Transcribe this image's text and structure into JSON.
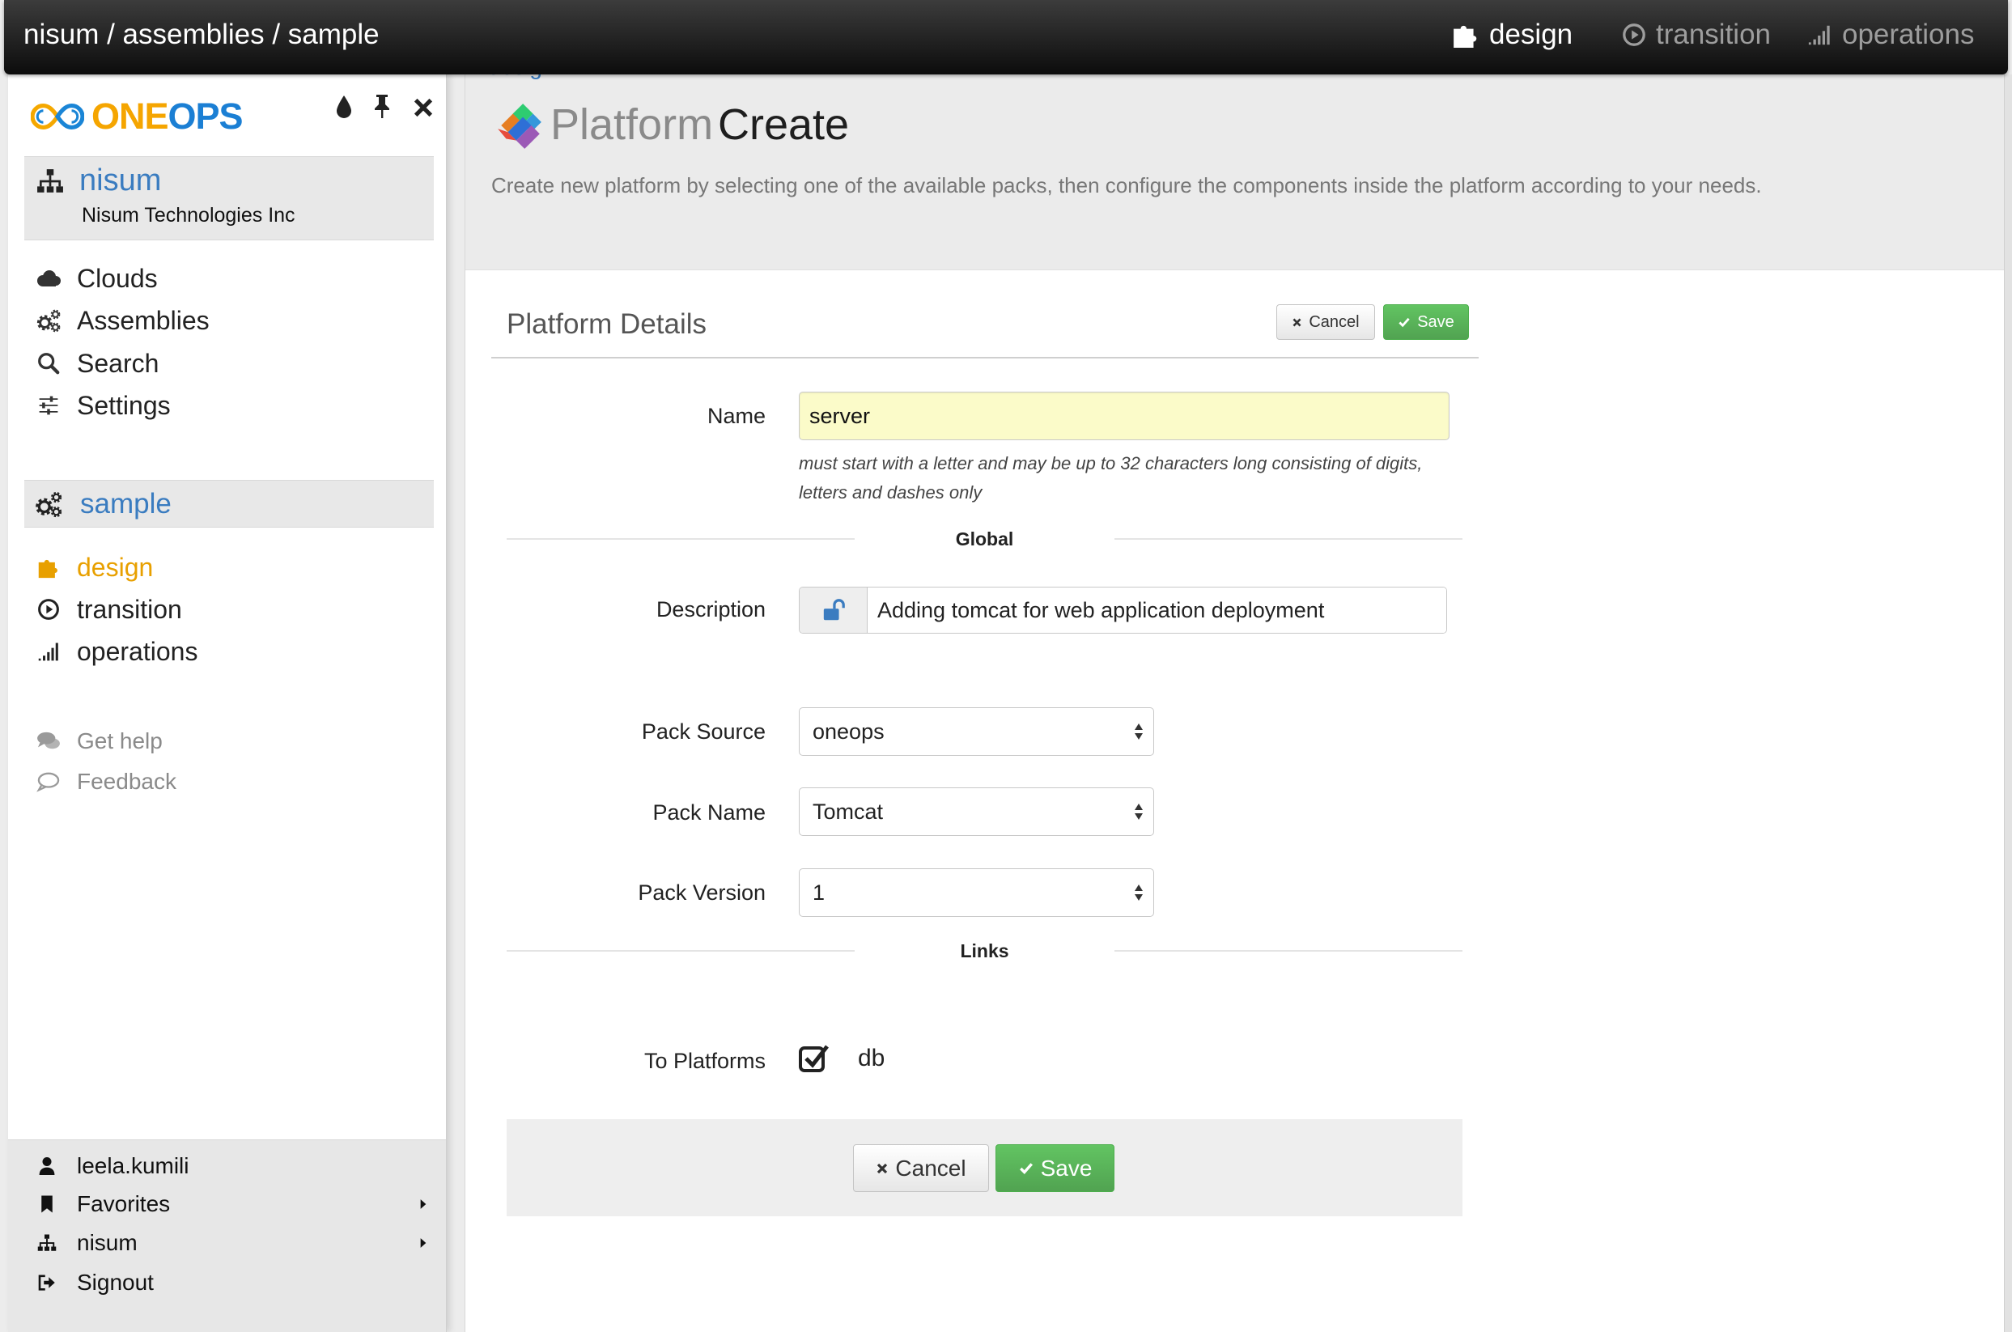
{
  "topbar": {
    "breadcrumb": "nisum / assemblies / sample",
    "nav": [
      {
        "label": "design",
        "icon": "puzzle-icon",
        "active": true
      },
      {
        "label": "transition",
        "icon": "play-circle-icon",
        "active": false
      },
      {
        "label": "operations",
        "icon": "signal-bars-icon",
        "active": false
      }
    ]
  },
  "sidebar": {
    "logo": {
      "part1": "ONE",
      "part2": "OPS",
      "icon": "infinity-logo-icon"
    },
    "toolbar_icons": [
      "droplet-icon",
      "pin-icon",
      "close-icon"
    ],
    "organization": {
      "name": "nisum",
      "full_name": "Nisum Technologies Inc",
      "icon": "sitemap-icon"
    },
    "menu": [
      {
        "label": "Clouds",
        "icon": "cloud-icon"
      },
      {
        "label": "Assemblies",
        "icon": "gears-icon"
      },
      {
        "label": "Search",
        "icon": "search-icon"
      },
      {
        "label": "Settings",
        "icon": "sliders-icon"
      }
    ],
    "assembly": {
      "name": "sample",
      "icon": "gears-icon"
    },
    "assembly_menu": [
      {
        "label": "design",
        "icon": "puzzle-icon",
        "active": true
      },
      {
        "label": "transition",
        "icon": "play-circle-icon",
        "active": false
      },
      {
        "label": "operations",
        "icon": "signal-bars-icon",
        "active": false
      }
    ],
    "help_links": [
      {
        "label": "Get help",
        "icon": "comments-icon"
      },
      {
        "label": "Feedback",
        "icon": "comment-outline-icon"
      }
    ],
    "user_menu": [
      {
        "label": "leela.kumili",
        "icon": "user-icon",
        "has_submenu": false
      },
      {
        "label": "Favorites",
        "icon": "bookmark-icon",
        "has_submenu": true
      },
      {
        "label": "nisum",
        "icon": "sitemap-icon",
        "has_submenu": true
      },
      {
        "label": "Signout",
        "icon": "sign-out-icon",
        "has_submenu": false
      }
    ]
  },
  "page": {
    "breadcrumb": "design",
    "icon": "platform-icon",
    "title_prefix": "Platform",
    "title": "Create",
    "description": "Create new platform by selecting one of the available packs, then configure the components inside the platform according to your needs."
  },
  "form": {
    "heading": "Platform Details",
    "top_cancel_label": "Cancel",
    "top_save_label": "Save",
    "name": {
      "label": "Name",
      "value": "server",
      "help": "must start with a letter and may be up to 32 characters long consisting of digits, letters and dashes only"
    },
    "section_global": "Global",
    "description": {
      "label": "Description",
      "value": "Adding tomcat for web application deployment",
      "lock_icon": "unlock-icon"
    },
    "pack_source": {
      "label": "Pack Source",
      "selected": "oneops"
    },
    "pack_name": {
      "label": "Pack Name",
      "selected": "Tomcat"
    },
    "pack_version": {
      "label": "Pack Version",
      "selected": "1"
    },
    "section_links": "Links",
    "to_platforms": {
      "label": "To Platforms",
      "options": [
        {
          "label": "db",
          "checked": true
        }
      ]
    },
    "footer_cancel_label": "Cancel",
    "footer_save_label": "Save"
  },
  "colors": {
    "link_blue": "#3a7cc0",
    "active_orange": "#e8a000",
    "save_green": "#5cb85c",
    "name_input_bg": "#fbfbc9"
  }
}
